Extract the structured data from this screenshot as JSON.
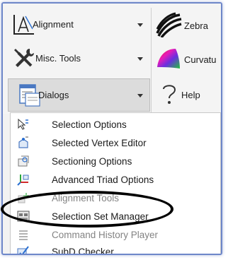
{
  "ribbon": {
    "alignment": {
      "label": "Alignment",
      "icon": "alignment-icon"
    },
    "misc_tools": {
      "label": "Misc. Tools",
      "icon": "wrench-screwdriver-icon"
    },
    "dialogs": {
      "label": "Dialogs",
      "icon": "dialog-window-icon"
    },
    "zebra": {
      "label": "Zebra",
      "icon": "zebra-stripes-icon"
    },
    "curvature": {
      "label": "Curvatu",
      "icon": "curvature-icon"
    },
    "help": {
      "label": "Help",
      "icon": "question-mark-icon"
    }
  },
  "menu": {
    "items": [
      {
        "label": "Selection Options",
        "icon": "selection-options-icon"
      },
      {
        "label": "Selected Vertex Editor",
        "icon": "vertex-editor-icon"
      },
      {
        "label": "Sectioning Options",
        "icon": "sectioning-icon"
      },
      {
        "label": "Advanced Triad Options",
        "icon": "triad-icon"
      },
      {
        "label": "Alignment Tools",
        "icon": "alignment-tools-icon"
      },
      {
        "label": "Selection Set Manager",
        "icon": "selection-set-icon"
      },
      {
        "label": "Command History Player",
        "icon": "command-history-icon"
      },
      {
        "label": "SubD Checker",
        "icon": "subd-checker-icon"
      }
    ]
  },
  "colors": {
    "accent_frame": "#6e87c9",
    "highlight_ellipse": "#000000"
  }
}
